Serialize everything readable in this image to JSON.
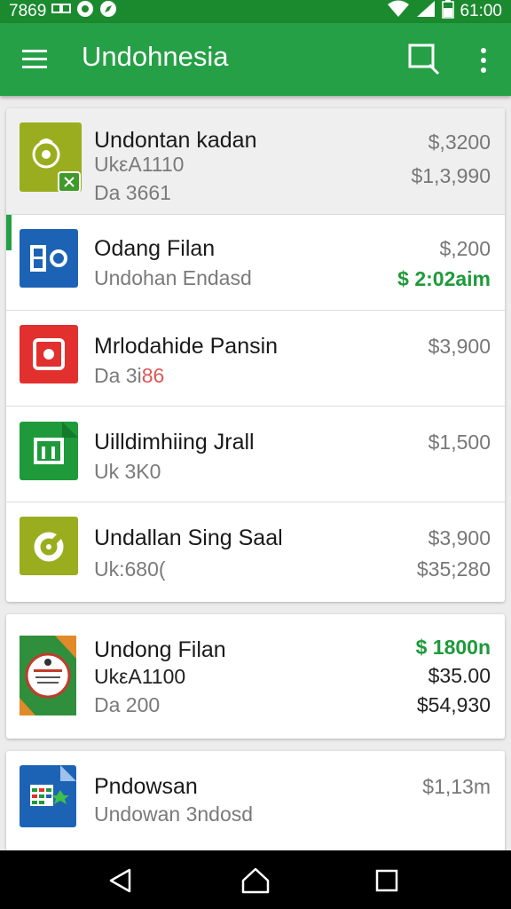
{
  "status_bar": {
    "left_text": "7869",
    "time": "61:00",
    "colors": {
      "background": "#1b8a2f"
    }
  },
  "app_bar": {
    "title": "Undohnesia",
    "colors": {
      "background": "#25a046"
    },
    "icons": [
      "menu-icon",
      "search-icon",
      "more-vert-icon"
    ]
  },
  "items": [
    {
      "title": "Undontan kadan",
      "line2": "UkεA1110",
      "line3": "Da 3661",
      "amounts": [
        "$,3200",
        "$1,3,990"
      ],
      "icon": "olive-badge-icon"
    },
    {
      "title": "Odang Filan",
      "line2": "Undohan Endasd",
      "amounts": [
        "$,200",
        "$ 2:02aim"
      ],
      "icon": "blue-bo-app-icon"
    },
    {
      "title": "Mrlodahide Pansin",
      "line2_prefix": "Da 3i",
      "line2_suffix": "86",
      "amounts": [
        "$3,900"
      ],
      "icon": "red-record-icon"
    },
    {
      "title": "Uilldimhiing Jrall",
      "line2": "Uk 3K0",
      "amounts": [
        "$1,500"
      ],
      "icon": "green-sheet-icon"
    },
    {
      "title": "Undallan Sing Saal",
      "line2": "Uk:680(",
      "amounts": [
        "$3,900",
        "$35;280"
      ],
      "icon": "olive-gauge-icon"
    },
    {
      "title": "Undong Filan",
      "line2": "UkεA1100",
      "line3": "Da 200",
      "amounts": [
        "$ 1800n",
        "$35.00",
        "$54,930"
      ],
      "icon": "holiday-card-icon"
    },
    {
      "title": "Pndowsan",
      "line2": "Undowan 3ndosd",
      "amounts": [
        "$1,13m"
      ],
      "icon": "blue-doc-icon"
    }
  ],
  "nav": {
    "icons": [
      "back-icon",
      "home-icon",
      "recents-icon"
    ]
  }
}
